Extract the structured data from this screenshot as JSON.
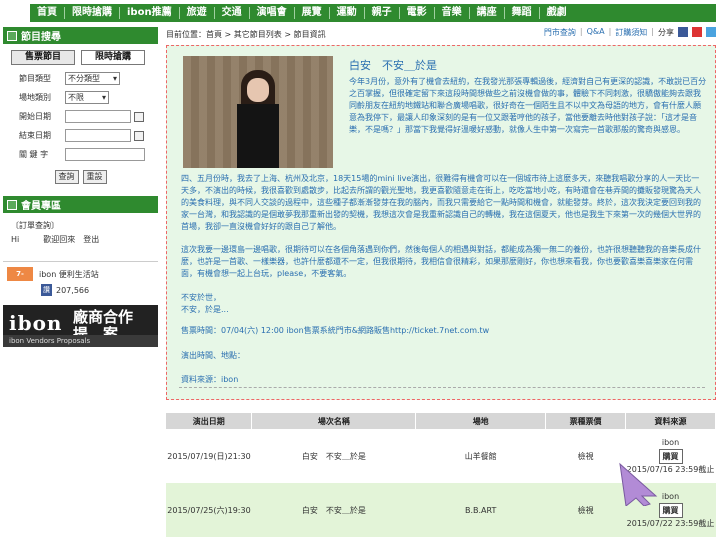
{
  "nav": [
    "首頁",
    "限時搶購",
    "ibon推薦",
    "旅遊",
    "交通",
    "演唱會",
    "展覽",
    "運動",
    "親子",
    "電影",
    "音樂",
    "講座",
    "舞蹈",
    "戲劇"
  ],
  "sidebar": {
    "section_title": "節目搜尋",
    "tab_tickets": "售票節目",
    "tab_flash": "限時搶購",
    "fields": {
      "type_label": "節目類型",
      "type_value": "不分類型",
      "area_label": "場地類別",
      "area_value": "不限",
      "start_label": "開始日期",
      "end_label": "結束日期",
      "keyword_label": "關 鍵 字"
    },
    "search_btn": "查詢",
    "reset_btn": "重設",
    "member_title": "會員專區",
    "order_query": "〔訂單查詢〕",
    "welcome": "Hi　　　歡迎回來　登出",
    "ibon_life_title": "ibon 便利生活站",
    "seven_label": "7-ELEVEN",
    "fb_like": "讚",
    "fb_count": "207,566",
    "banner_logo": "ibon",
    "banner_tag_1": "廠商合作",
    "banner_tag_2": "提　案",
    "banner_sub": "ibon Vendors Proposals"
  },
  "breadcrumb": "目前位置：首頁 > 其它節目列表 > 節目資訊",
  "toplinks": {
    "store_query": "門市查詢",
    "qa": "Q&A",
    "notice": "訂購須知",
    "share": "分享"
  },
  "event": {
    "title": "白安　不安＿於是",
    "p1": "今年3月份，意外有了機會去紐約，在我發光那張專輯過後，經濟對自己有更深的認識，不敢說已百分之百掌握，但很確定留下來這段時間想做些之前沒機會做的事，體驗下不同刺激，很驕傲能夠去跟我同齡朋友在紐約地鐵站和聯合廣場唱歌，很好奇在一個陌生且不以中文為母語的地方，會有什麼人願意為我停下，最讓人印象深刻的是有一位又跟著哼他的孩子，當他要離去時他對孩子說：「這才是音樂，不是嗎？」那當下我覺得好溫暖好感動，就像人生中第一次寫完一首歌那般的驚奇與感恩。",
    "p2": "四、五月份時，我去了上海、杭州及北京，18天15場的mini live演出，很難得有機會可以在一個城市待上這麼多天，來聽我唱歌分享的人一天比一天多，不演出的時候，我很喜歡到處散步，比起去所謂的觀光聖地，我更喜歡隨意走在街上，吃吃當地小吃，有時還會在巷弄間的攤販發現驚為天人的美食料理，與不同人交談的過程中，這些種子都漸漸發芽在我的腦內，而我只需要給它一點時間和機會，就能發芽。終於，這次我決定要回到我的家一台灣，和我認識的是個敢夢我那重新出發的契機，我想這次會是我重新認識自己的轉機，我在這個夏天，他也是我生下來第一次的幾個大世界的首場，我卻一直沒機會好好的跟自己了解他。",
    "p3": "這次我要一邊環島一邊唱歌，很期待可以在各個角落遇到你們，然後每個人的相遇與對話，都能成為獨一無二的養份，也許很想聽聽我的音樂長成什麼，也許是一首歌、一樣樂器，也許什麼都還不一定，但我很期待，我相信會很精彩，如果那麼剛好，你也想來看我，你也要歡喜樂喜樂家在何需面，有機會想一起上台玩，please，不要客氣。",
    "p4_1": "不安於世，",
    "p4_2": "不安，於是...",
    "sale_time": "售票時間：07/04(六) 12:00 ibon售票系統門市&網路販售http://ticket.7net.com.tw",
    "show_time": "演出時間、地點：",
    "source_label": "資料來源：",
    "source_value": "ibon"
  },
  "table": {
    "headers": [
      "演出日期",
      "場次名稱",
      "場地",
      "票種票價",
      "資料來源"
    ],
    "rows": [
      {
        "date": "2015/07/19(日)21:30",
        "name": "白安　不安＿於是",
        "venue": "山羊餐館",
        "price": "檢視",
        "source": "ibon",
        "buy": "購買",
        "deadline": "2015/07/16 23:59截止"
      },
      {
        "date": "2015/07/25(六)19:30",
        "name": "白安　不安＿於是",
        "venue": "B.B.ART",
        "price": "檢視",
        "source": "ibon",
        "buy": "購買",
        "deadline": "2015/07/22 23:59截止"
      }
    ]
  },
  "colors": {
    "brand_green": "#2f8a2f",
    "content_bg": "#e7f7e7",
    "link_blue": "#2a6fb0",
    "row_highlight": "#e3f4d8",
    "arrow_purple": "#b28bd6"
  }
}
